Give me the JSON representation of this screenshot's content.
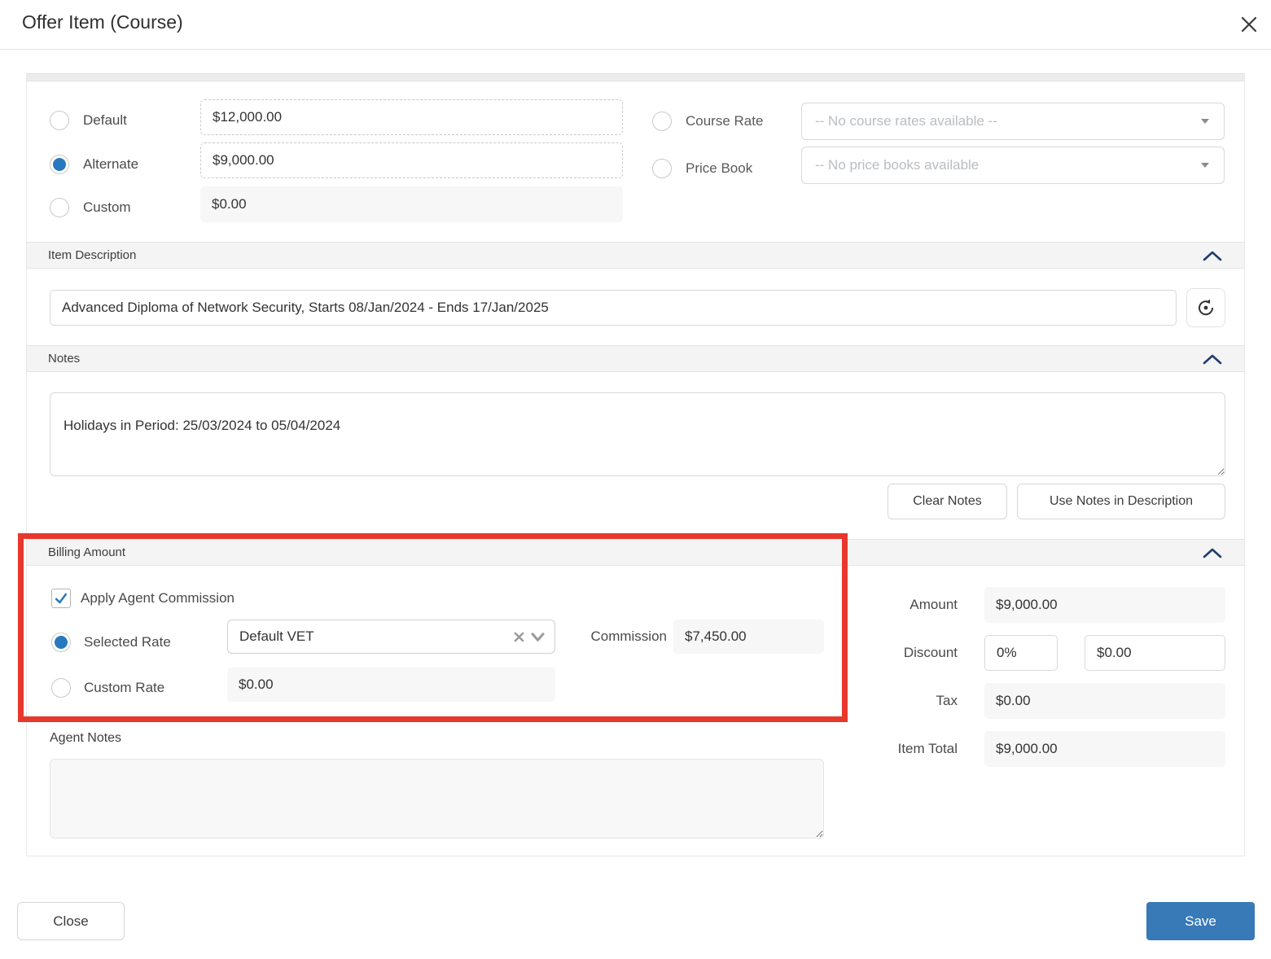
{
  "colors": {
    "accent_blue": "#2878be",
    "chevron_navy": "#1f3d6e",
    "annotation_red": "#e8382d",
    "save_blue": "#3879b7"
  },
  "modal": {
    "title": "Offer Item (Course)"
  },
  "rates": {
    "options": [
      {
        "label": "Default",
        "value": "$12,000.00",
        "selected": false
      },
      {
        "label": "Alternate",
        "value": "$9,000.00",
        "selected": true
      },
      {
        "label": "Custom",
        "value": "$0.00",
        "selected": false
      }
    ],
    "course_rate": {
      "label": "Course Rate",
      "placeholder": "-- No course rates available --",
      "selected": false
    },
    "price_book": {
      "label": "Price Book",
      "placeholder": "-- No price books available",
      "selected": false
    }
  },
  "item_description": {
    "header": "Item Description",
    "value": "Advanced Diploma of Network Security, Starts 08/Jan/2024 - Ends 17/Jan/2025"
  },
  "notes": {
    "header": "Notes",
    "value": "Holidays in Period: 25/03/2024 to 05/04/2024",
    "clear_button": "Clear Notes",
    "use_button": "Use Notes in Description"
  },
  "billing": {
    "header": "Billing Amount",
    "apply_commission": {
      "label": "Apply Agent Commission",
      "checked": true
    },
    "selected_rate": {
      "label": "Selected Rate",
      "value": "Default VET",
      "selected": true
    },
    "commission": {
      "label": "Commission",
      "value": "$7,450.00"
    },
    "custom_rate": {
      "label": "Custom Rate",
      "value": "$0.00",
      "selected": false
    },
    "agent_notes": {
      "label": "Agent Notes",
      "value": ""
    }
  },
  "summary": {
    "amount": {
      "label": "Amount",
      "value": "$9,000.00"
    },
    "discount": {
      "label": "Discount",
      "percent": "0%",
      "amount": "$0.00"
    },
    "tax": {
      "label": "Tax",
      "value": "$0.00"
    },
    "item_total": {
      "label": "Item Total",
      "value": "$9,000.00"
    }
  },
  "footer": {
    "close_label": "Close",
    "save_label": "Save"
  }
}
